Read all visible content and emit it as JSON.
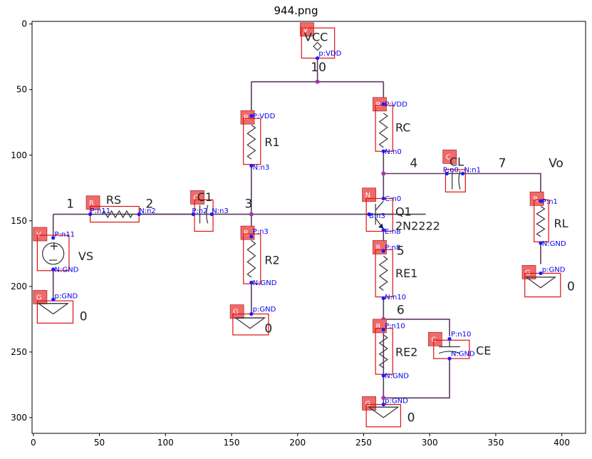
{
  "title": "944.png",
  "axes": {
    "xlim": [
      -1,
      418
    ],
    "ylim": [
      312,
      -2
    ],
    "xticks": [
      0,
      50,
      100,
      150,
      200,
      250,
      300,
      350,
      400
    ],
    "yticks": [
      0,
      50,
      100,
      150,
      200,
      250,
      300
    ]
  },
  "components": [
    {
      "id": "vcc",
      "tag": "V",
      "label": "VCC"
    },
    {
      "id": "r1",
      "tag": "R",
      "label": "R1"
    },
    {
      "id": "rc",
      "tag": "R",
      "label": "RC"
    },
    {
      "id": "cl",
      "tag": "C",
      "label": "CL"
    },
    {
      "id": "rs",
      "tag": "R",
      "label": "RS"
    },
    {
      "id": "c1",
      "tag": "C",
      "label": "C1"
    },
    {
      "id": "q1",
      "tag": "N",
      "label": "Q1",
      "model": "2N2222"
    },
    {
      "id": "rl",
      "tag": "R",
      "label": "RL"
    },
    {
      "id": "vs",
      "tag": "V",
      "label": "VS"
    },
    {
      "id": "r2",
      "tag": "R",
      "label": "R2"
    },
    {
      "id": "re1",
      "tag": "R",
      "label": "RE1"
    },
    {
      "id": "re2",
      "tag": "R",
      "label": "RE2"
    },
    {
      "id": "ce",
      "tag": "C",
      "label": "CE"
    },
    {
      "id": "g1",
      "tag": "G",
      "label": "0"
    },
    {
      "id": "g2",
      "tag": "G",
      "label": "0"
    },
    {
      "id": "g3",
      "tag": "G",
      "label": "0"
    },
    {
      "id": "g4",
      "tag": "G",
      "label": "0"
    }
  ],
  "node_labels": [
    "10",
    "1",
    "2",
    "3",
    "4",
    "7",
    "Vo",
    "5",
    "6"
  ],
  "pins": [
    "p:VDD",
    "P:VDD",
    "N:n3",
    "P:VDD",
    "N:n0",
    "P:n0",
    "N:n1",
    "P:n11",
    "N:n2",
    "P:n2",
    "N:n3",
    "C:n0",
    "B:n3",
    "E:n8",
    "P:n1",
    "N:GND",
    "P:n11",
    "N:GND",
    "p:GND",
    "P:n3",
    "N:GND",
    "p:GND",
    "P:n8",
    "N:n10",
    "P:n10",
    "N:GND",
    "P:n10",
    "N:GND",
    "p:GND",
    "p:GND"
  ]
}
